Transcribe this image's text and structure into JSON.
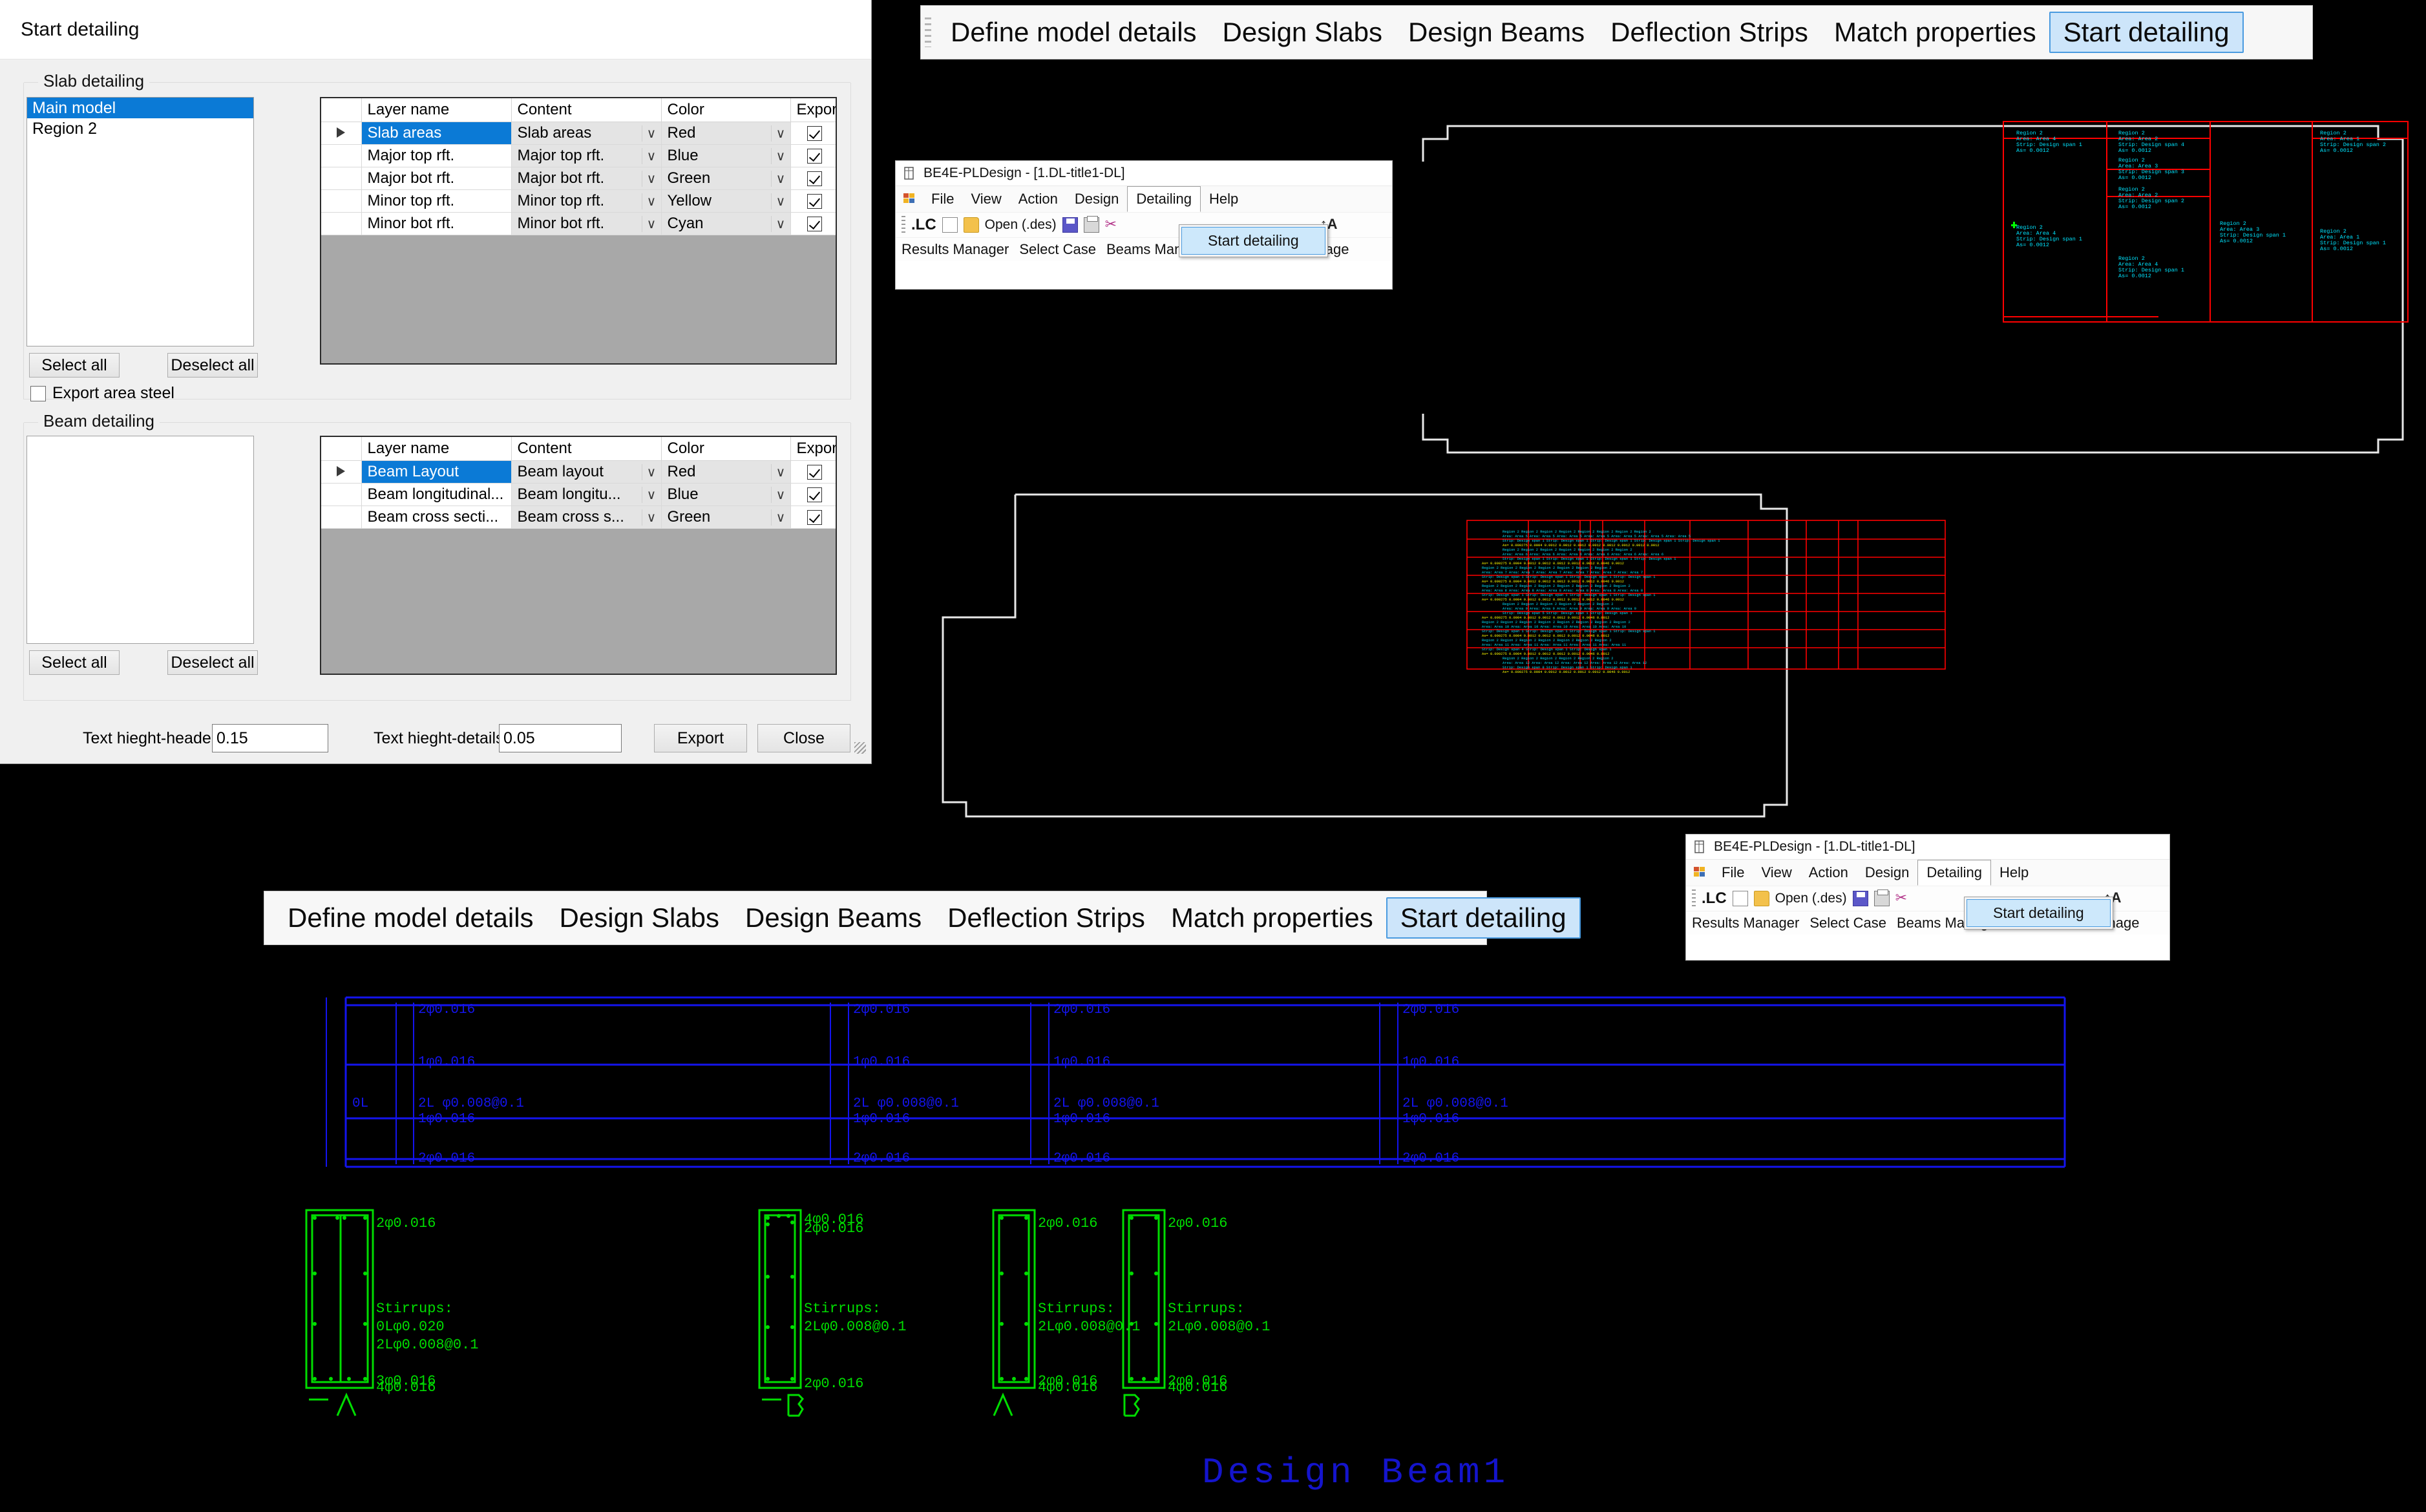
{
  "dialog": {
    "title": "Start detailing",
    "slab_group": {
      "legend": "Slab detailing",
      "models": [
        "Main model",
        "Region 2"
      ],
      "selected_model": "Main model",
      "select_all_label": "Select all",
      "deselect_all_label": "Deselect all",
      "export_area_steel_label": "Export area steel",
      "export_area_steel_checked": false,
      "grid": {
        "columns": [
          "",
          "Layer name",
          "Content",
          "Color",
          "Export"
        ],
        "rows": [
          {
            "selected": true,
            "layer_name": "Slab areas",
            "content": "Slab areas",
            "color": "Red",
            "export": true
          },
          {
            "selected": false,
            "layer_name": "Major top rft.",
            "content": "Major top rft.",
            "color": "Blue",
            "export": true
          },
          {
            "selected": false,
            "layer_name": "Major bot rft.",
            "content": "Major bot rft.",
            "color": "Green",
            "export": true
          },
          {
            "selected": false,
            "layer_name": "Minor top rft.",
            "content": "Minor top rft.",
            "color": "Yellow",
            "export": true
          },
          {
            "selected": false,
            "layer_name": "Minor bot rft.",
            "content": "Minor bot rft.",
            "color": "Cyan",
            "export": true
          }
        ]
      }
    },
    "beam_group": {
      "legend": "Beam detailing",
      "models": [],
      "select_all_label": "Select all",
      "deselect_all_label": "Deselect all",
      "grid": {
        "columns": [
          "",
          "Layer name",
          "Content",
          "Color",
          "Export"
        ],
        "rows": [
          {
            "selected": true,
            "layer_name": "Beam Layout",
            "content": "Beam layout",
            "color": "Red",
            "export": true
          },
          {
            "selected": false,
            "layer_name": "Beam longitudinal...",
            "content": "Beam longitu...",
            "color": "Blue",
            "export": true
          },
          {
            "selected": false,
            "layer_name": "Beam cross secti...",
            "content": "Beam cross s...",
            "color": "Green",
            "export": true
          }
        ]
      }
    },
    "footer": {
      "text_height_headers_label": "Text hieght-headers:",
      "text_height_headers_value": "0.15",
      "text_height_details_label": "Text hieght-details:",
      "text_height_details_value": "0.05",
      "export_label": "Export",
      "close_label": "Close"
    }
  },
  "ribbon": {
    "tabs": [
      "Define model details",
      "Design Slabs",
      "Design Beams",
      "Deflection Strips",
      "Match properties",
      "Start detailing"
    ],
    "active_tab": "Start detailing"
  },
  "app_window": {
    "title": "BE4E-PLDesign - [1.DL-title1-DL]",
    "menus": [
      "File",
      "View",
      "Action",
      "Design",
      "Detailing",
      "Help"
    ],
    "open_menu": "Detailing",
    "menu_items": [
      "Start detailing"
    ],
    "toolbar": {
      "lc_label": ".LC",
      "open_label": "Open (.des)",
      "icons": [
        "new-document-icon",
        "open-folder-icon",
        "save-icon",
        "print-icon",
        "cut-icon",
        "axis-icon"
      ]
    },
    "status_items": [
      "Results Manager",
      "Select Case",
      "Beams Manager",
      "Assemblies Manage"
    ]
  },
  "cad": {
    "colors": {
      "slab_outline": "#e8e8e8",
      "region_box": "#ff0000",
      "strip_text": "#00e5ff",
      "steel_text": "#ffff00",
      "node_marker": "#00ff00",
      "beam_layout": "#0000ff",
      "beam_section": "#00ff00",
      "title_text": "#0000cc"
    },
    "top_right_plan": {
      "label_lines": [
        [
          "Region 2",
          "Area: Area 4",
          "Strip: Design span 1",
          "As= 0.0012"
        ],
        [
          "Region 2",
          "Area: Area 2",
          "Strip: Design span 4",
          "As= 0.0012"
        ],
        [
          "Region 2",
          "Area: Area 3",
          "Strip: Design span 3",
          "As= 0.0012"
        ],
        [
          "Region 2",
          "Area: Area 2",
          "Strip: Design span 2",
          "As= 0.0012"
        ],
        [
          "Region 2",
          "Area: Area 3",
          "Strip: Design span 1",
          "As= 0.0012"
        ],
        [
          "Region 2",
          "Area: Area 1",
          "Strip: Design span 2",
          "As= 0.0012"
        ],
        [
          "Region 2",
          "Area: Area 1",
          "Strip: Design span 1",
          "As= 0.0012"
        ],
        [
          "Region 2",
          "Area: Area 4",
          "Strip: Design span 1",
          "As= 0.0012"
        ]
      ]
    },
    "middle_plan": {
      "region_label": "Region 2",
      "area_labels": [
        "Area: Area 5",
        "Area: Area 6",
        "Area: Area 7",
        "Area: Area 8",
        "Area: Area 9",
        "Area: Area 10",
        "Area: Area 11",
        "Area: Area 12"
      ],
      "strip_label": "Strip: Design span 1",
      "as_label": "As= 0.0012"
    },
    "beam_layout": {
      "top_bar_label": "2φ0.016",
      "mid_bar_label": "1φ0.016",
      "stirrup_label": "2L φ0.008@0.1",
      "bot_bar_label": "2φ0.016"
    },
    "beam_sections": [
      {
        "tag": "— A",
        "top": "2φ0.016",
        "stirrups_title": "Stirrups:",
        "stirrups": [
          "0Lφ0.020",
          "2Lφ0.008@0.1"
        ],
        "bottom": [
          "3φ0.016",
          "4φ0.016"
        ]
      },
      {
        "tag": "— B",
        "top": "4φ0.016",
        "top2": "2φ0.016",
        "stirrups_title": "Stirrups:",
        "stirrups": [
          "2Lφ0.008@0.1"
        ],
        "bottom": [
          "2φ0.016"
        ]
      },
      {
        "tag": "A",
        "top": "2φ0.016",
        "stirrups_title": "Stirrups:",
        "stirrups": [
          "2Lφ0.008@0.1"
        ],
        "bottom": [
          "2φ0.016",
          "4φ0.016"
        ]
      },
      {
        "tag": "B",
        "top": "2φ0.016",
        "stirrups_title": "Stirrups:",
        "stirrups": [
          "2Lφ0.008@0.1"
        ],
        "bottom": [
          "2φ0.016",
          "4φ0.016"
        ]
      }
    ],
    "drawing_title": "Design Beam1"
  }
}
